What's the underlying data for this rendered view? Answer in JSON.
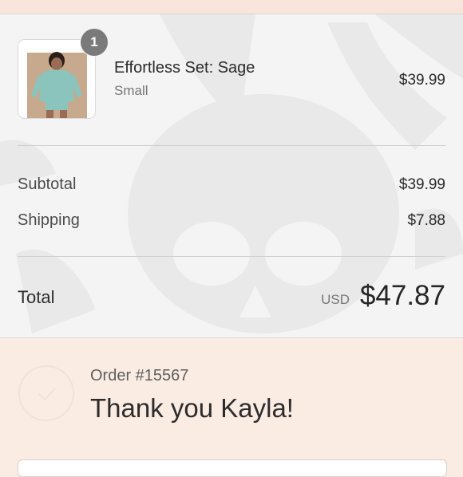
{
  "order_summary": {
    "item": {
      "quantity": "1",
      "name": "Effortless Set: Sage",
      "variant": "Small",
      "price": "$39.99",
      "image_icon": "product-photo"
    },
    "subtotal": {
      "label": "Subtotal",
      "value": "$39.99"
    },
    "shipping": {
      "label": "Shipping",
      "value": "$7.88"
    },
    "total": {
      "label": "Total",
      "currency": "USD",
      "value": "$47.87"
    }
  },
  "confirmation": {
    "order_number": "Order #15567",
    "thank_you": "Thank you Kayla!",
    "icon": "check-icon"
  },
  "colors": {
    "page_background": "#fbece3",
    "summary_background": "#f4f4f4",
    "badge": "#7a7a7a",
    "text": "#2a2a2a"
  }
}
